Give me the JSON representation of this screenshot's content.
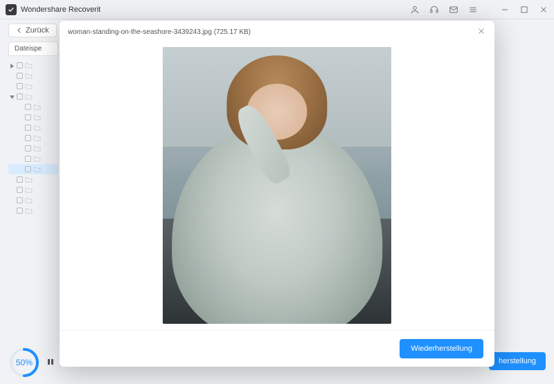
{
  "app": {
    "title": "Wondershare Recoverit"
  },
  "toolbar": {
    "back_label": "Zurück"
  },
  "sidebar": {
    "tab_label": "Dateispe"
  },
  "progress": {
    "percent": "50",
    "percent_suffix": "%"
  },
  "corner_button": {
    "label": "herstellung"
  },
  "modal": {
    "filename": "woman-standing-on-the-seashore-3439243.jpg (725.17 KB)",
    "recover_label": "Wiederherstellung"
  }
}
